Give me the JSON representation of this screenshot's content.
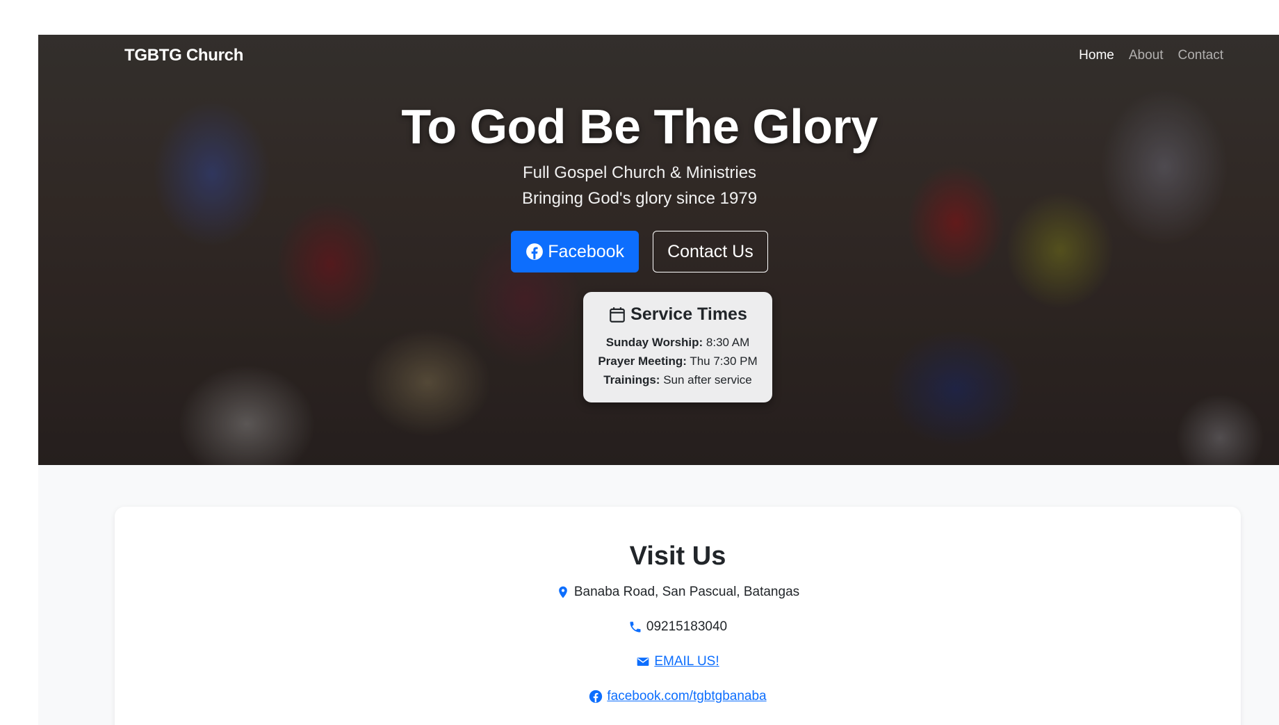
{
  "nav": {
    "brand": "TGBTG Church",
    "links": [
      {
        "label": "Home",
        "active": true
      },
      {
        "label": "About",
        "active": false
      },
      {
        "label": "Contact",
        "active": false
      }
    ]
  },
  "hero": {
    "title": "To God Be The Glory",
    "subtitle_line1": "Full Gospel Church & Ministries",
    "subtitle_line2": "Bringing God's glory since 1979",
    "buttons": {
      "facebook": "Facebook",
      "contact": "Contact Us"
    },
    "background": "group photo of church members"
  },
  "service_times": {
    "title": "Service Times",
    "items": [
      {
        "label": "Sunday Worship:",
        "value": "8:30 AM"
      },
      {
        "label": "Prayer Meeting:",
        "value": "Thu 7:30 PM"
      },
      {
        "label": "Trainings:",
        "value": "Sun after service"
      }
    ]
  },
  "visit": {
    "title": "Visit Us",
    "address": "Banaba Road, San Pascual, Batangas",
    "phone": "09215183040",
    "email_label": "EMAIL US!",
    "facebook_link": "facebook.com/tgbtgbanaba"
  },
  "colors": {
    "primary": "#0d6efd",
    "text": "#212529",
    "page_bg": "#f8f9fa"
  },
  "icons": {
    "facebook": "facebook-icon",
    "calendar": "calendar-icon",
    "location": "map-pin-icon",
    "phone": "phone-icon",
    "email": "envelope-icon"
  }
}
